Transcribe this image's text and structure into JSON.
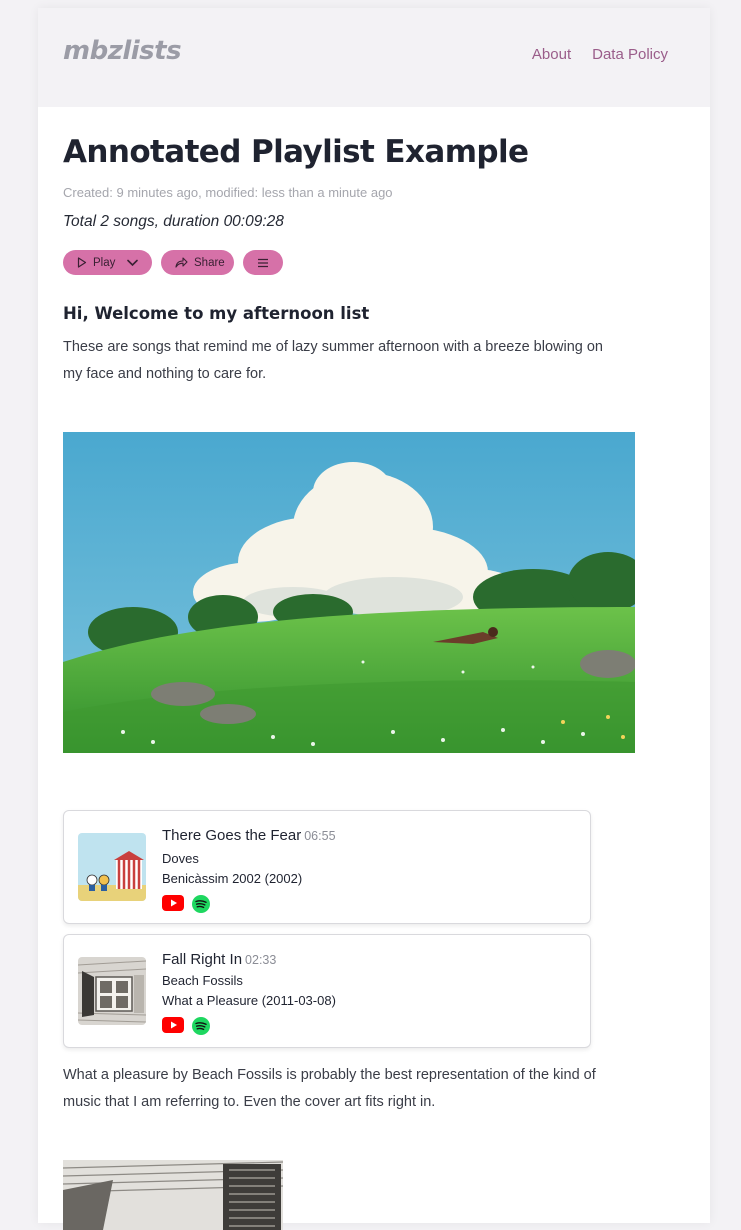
{
  "brand": "mbzlists",
  "nav": {
    "about": "About",
    "data_policy": "Data Policy"
  },
  "playlist": {
    "title": "Annotated Playlist Example",
    "meta": "Created: 9 minutes ago, modified: less than a minute ago",
    "summary": "Total 2 songs, duration 00:09:28"
  },
  "buttons": {
    "play": "Play",
    "share": "Share"
  },
  "intro": {
    "heading": "Hi, Welcome to my afternoon list",
    "text": "These are songs that remind me of lazy summer afternoon with a breeze blowing on my face and nothing to care for."
  },
  "tracks": [
    {
      "title": "There Goes the Fear",
      "duration": "06:55",
      "artist": "Doves",
      "release": "Benicàssim 2002 (2002)"
    },
    {
      "title": "Fall Right In",
      "duration": "02:33",
      "artist": "Beach Fossils",
      "release": "What a Pleasure (2011-03-08)"
    }
  ],
  "note": "What a pleasure by Beach Fossils is probably the best representation of the kind of music that I am referring to. Even the cover art fits right in.",
  "colors": {
    "accent": "#d671a8",
    "nav_link": "#9a5d8a",
    "youtube": "#ff0000",
    "spotify": "#1ed760"
  },
  "icons": [
    "play-icon",
    "chevron-down-icon",
    "share-icon",
    "menu-icon",
    "youtube-icon",
    "spotify-icon"
  ]
}
